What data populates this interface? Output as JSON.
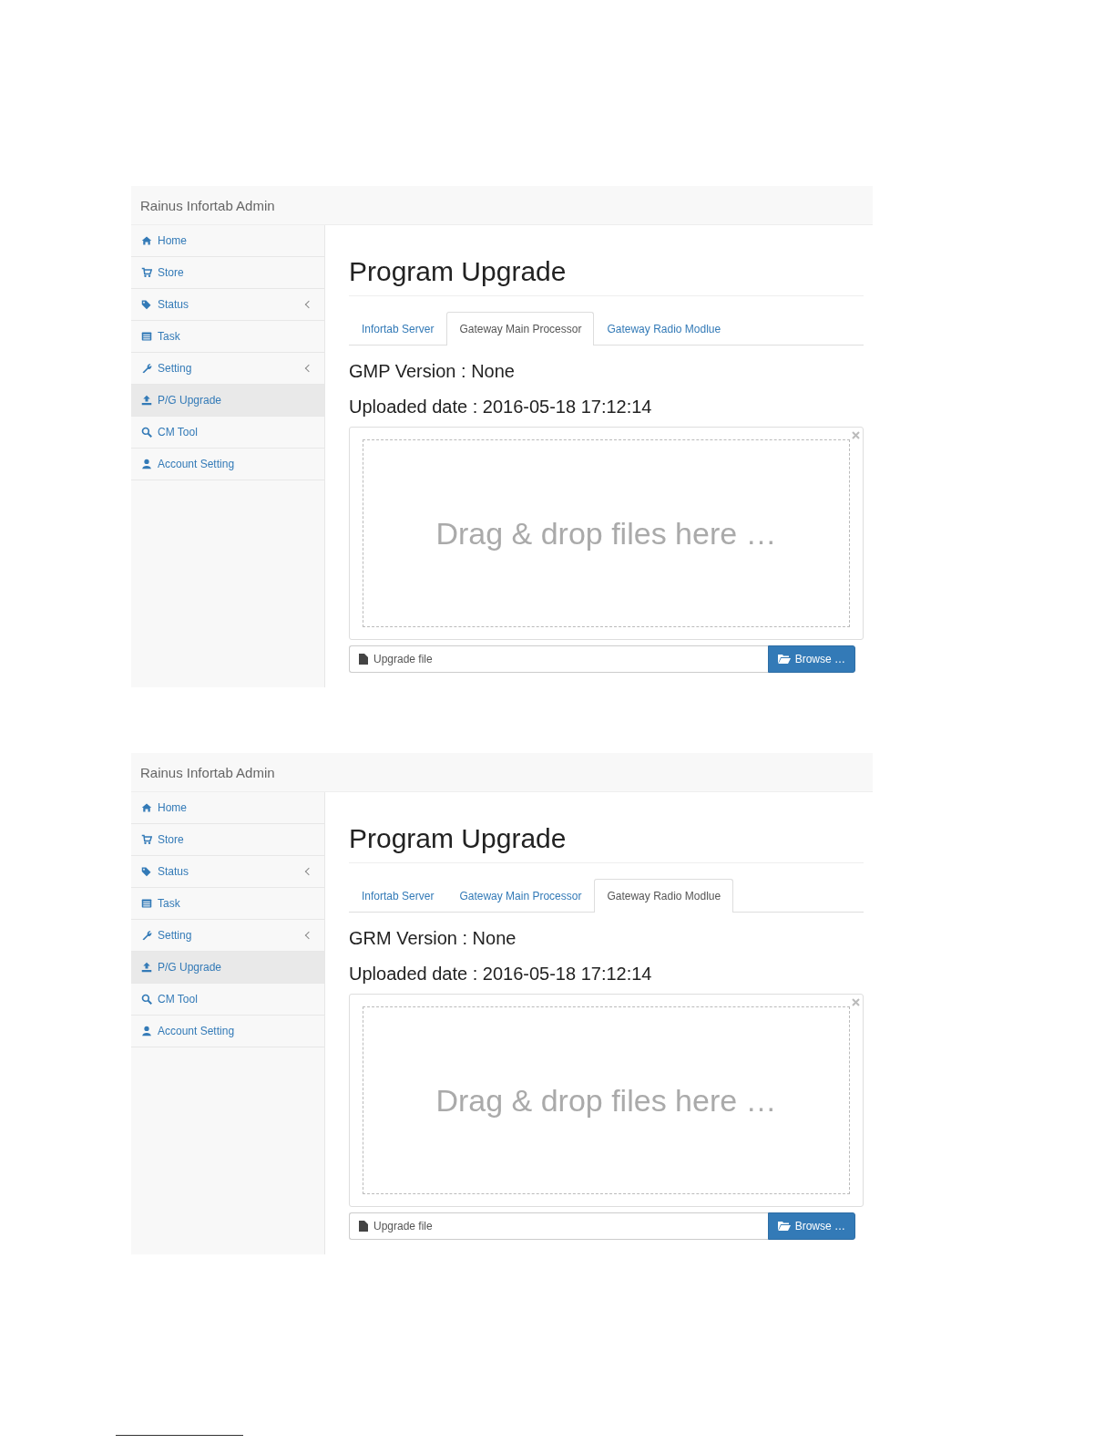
{
  "panels": [
    {
      "brand": "Rainus Infortab Admin",
      "nav": [
        {
          "label": "Home",
          "selected": false,
          "submenu": false
        },
        {
          "label": "Store",
          "selected": false,
          "submenu": false
        },
        {
          "label": "Status",
          "selected": false,
          "submenu": true
        },
        {
          "label": "Task",
          "selected": false,
          "submenu": false
        },
        {
          "label": "Setting",
          "selected": false,
          "submenu": true
        },
        {
          "label": "P/G Upgrade",
          "selected": true,
          "submenu": false
        },
        {
          "label": "CM Tool",
          "selected": false,
          "submenu": false
        },
        {
          "label": "Account Setting",
          "selected": false,
          "submenu": false
        }
      ],
      "title": "Program Upgrade",
      "tabs": [
        {
          "label": "Infortab Server",
          "selected": false
        },
        {
          "label": "Gateway Main Processor",
          "selected": true
        },
        {
          "label": "Gateway Radio Modlue",
          "selected": false
        }
      ],
      "version": "GMP Version : None",
      "uploaded": "Uploaded date : 2016-05-18 17:12:14",
      "dropzone": "Drag & drop files here …",
      "file_placeholder": "Upgrade file",
      "browse": "Browse …"
    },
    {
      "brand": "Rainus Infortab Admin",
      "nav": [
        {
          "label": "Home",
          "selected": false,
          "submenu": false
        },
        {
          "label": "Store",
          "selected": false,
          "submenu": false
        },
        {
          "label": "Status",
          "selected": false,
          "submenu": true
        },
        {
          "label": "Task",
          "selected": false,
          "submenu": false
        },
        {
          "label": "Setting",
          "selected": false,
          "submenu": true
        },
        {
          "label": "P/G Upgrade",
          "selected": true,
          "submenu": false
        },
        {
          "label": "CM Tool",
          "selected": false,
          "submenu": false
        },
        {
          "label": "Account Setting",
          "selected": false,
          "submenu": false
        }
      ],
      "title": "Program Upgrade",
      "tabs": [
        {
          "label": "Infortab Server",
          "selected": false
        },
        {
          "label": "Gateway Main Processor",
          "selected": false
        },
        {
          "label": "Gateway Radio Modlue",
          "selected": true
        }
      ],
      "version": "GRM Version : None",
      "uploaded": "Uploaded date : 2016-05-18 17:12:14",
      "dropzone": "Drag & drop files here …",
      "file_placeholder": "Upgrade file",
      "browse": "Browse …"
    }
  ]
}
